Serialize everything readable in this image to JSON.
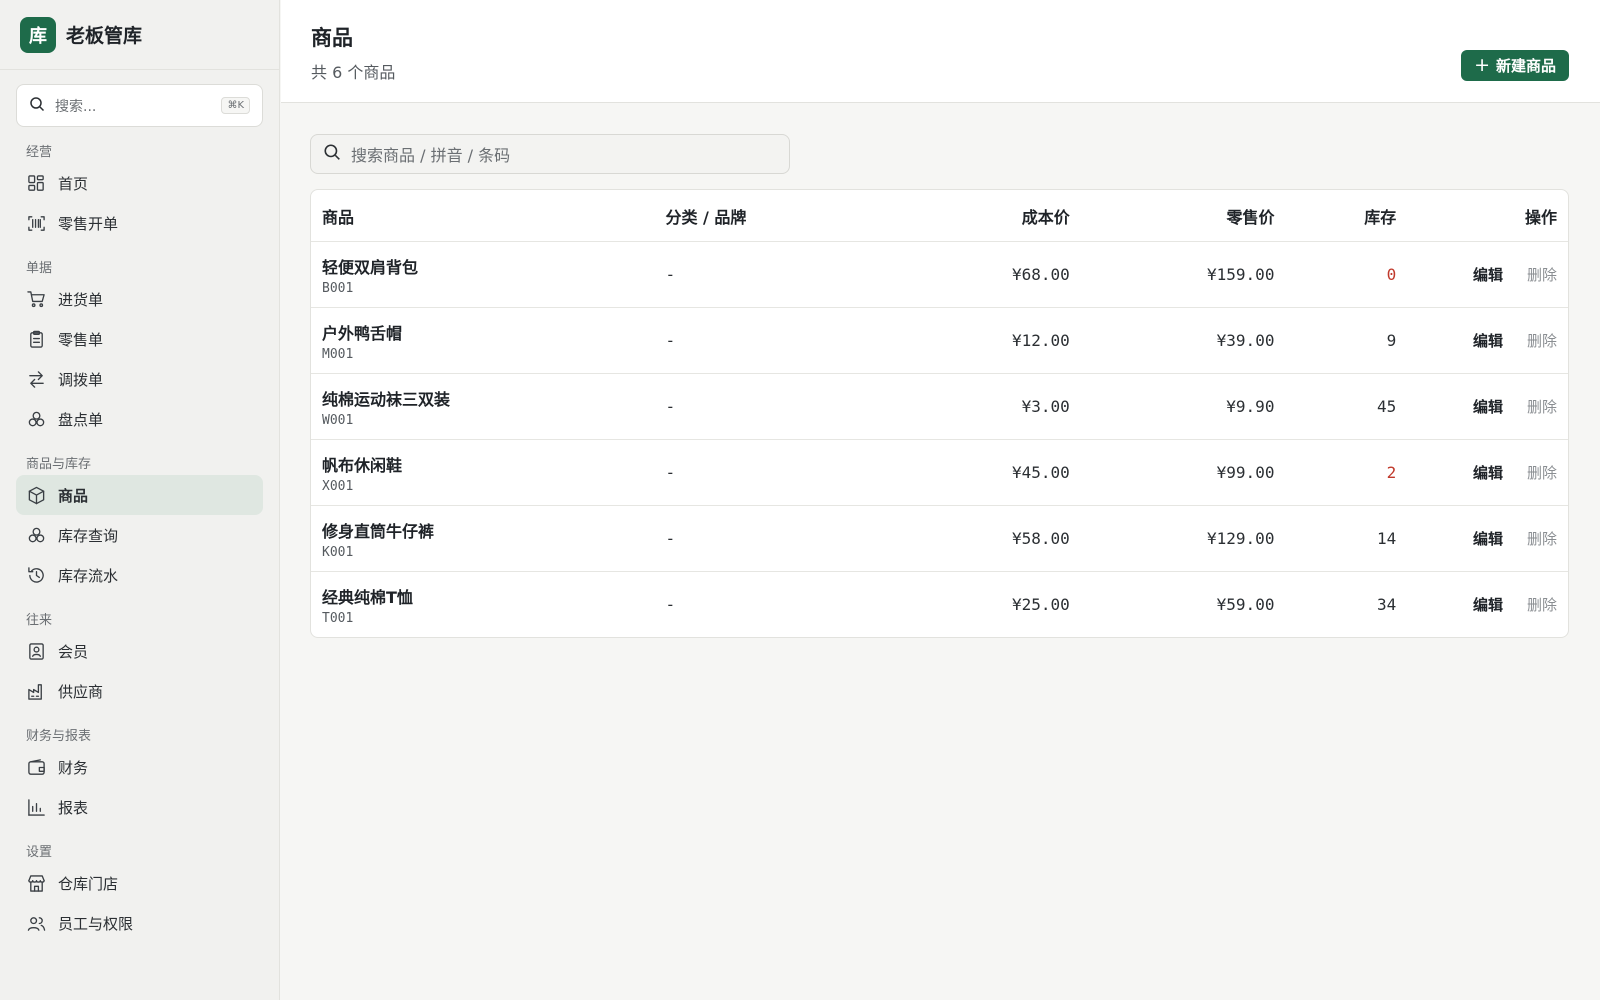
{
  "brand": {
    "logo": "库",
    "name": "老板管库"
  },
  "sidebar_search": {
    "placeholder": "搜索...",
    "shortcut": "⌘K"
  },
  "nav": [
    {
      "title": "经营",
      "items": [
        {
          "label": "首页",
          "icon": "dashboard-icon"
        },
        {
          "label": "零售开单",
          "icon": "scan-icon"
        }
      ]
    },
    {
      "title": "单据",
      "items": [
        {
          "label": "进货单",
          "icon": "cart-icon"
        },
        {
          "label": "零售单",
          "icon": "clipboard-icon"
        },
        {
          "label": "调拨单",
          "icon": "transfer-icon"
        },
        {
          "label": "盘点单",
          "icon": "boxes-icon"
        }
      ]
    },
    {
      "title": "商品与库存",
      "items": [
        {
          "label": "商品",
          "icon": "package-icon",
          "active": true
        },
        {
          "label": "库存查询",
          "icon": "boxes-icon"
        },
        {
          "label": "库存流水",
          "icon": "history-icon"
        }
      ]
    },
    {
      "title": "往来",
      "items": [
        {
          "label": "会员",
          "icon": "contact-icon"
        },
        {
          "label": "供应商",
          "icon": "factory-icon"
        }
      ]
    },
    {
      "title": "财务与报表",
      "items": [
        {
          "label": "财务",
          "icon": "wallet-icon"
        },
        {
          "label": "报表",
          "icon": "bar-chart-icon"
        }
      ]
    },
    {
      "title": "设置",
      "items": [
        {
          "label": "仓库门店",
          "icon": "store-icon"
        },
        {
          "label": "员工与权限",
          "icon": "users-icon"
        }
      ]
    }
  ],
  "header": {
    "title": "商品",
    "subtitle": "共 6 个商品",
    "new_button": "新建商品"
  },
  "search": {
    "placeholder": "搜索商品 / 拼音 / 条码"
  },
  "table": {
    "columns": [
      "商品",
      "分类 / 品牌",
      "成本价",
      "零售价",
      "库存",
      "操作"
    ],
    "rows": [
      {
        "name": "轻便双肩背包",
        "code": "B001",
        "category": "-",
        "cost": "¥68.00",
        "price": "¥159.00",
        "stock": "0",
        "low": true
      },
      {
        "name": "户外鸭舌帽",
        "code": "M001",
        "category": "-",
        "cost": "¥12.00",
        "price": "¥39.00",
        "stock": "9",
        "low": false
      },
      {
        "name": "纯棉运动袜三双装",
        "code": "W001",
        "category": "-",
        "cost": "¥3.00",
        "price": "¥9.90",
        "stock": "45",
        "low": false
      },
      {
        "name": "帆布休闲鞋",
        "code": "X001",
        "category": "-",
        "cost": "¥45.00",
        "price": "¥99.00",
        "stock": "2",
        "low": true
      },
      {
        "name": "修身直筒牛仔裤",
        "code": "K001",
        "category": "-",
        "cost": "¥58.00",
        "price": "¥129.00",
        "stock": "14",
        "low": false
      },
      {
        "name": "经典纯棉T恤",
        "code": "T001",
        "category": "-",
        "cost": "¥25.00",
        "price": "¥59.00",
        "stock": "34",
        "low": false
      }
    ],
    "edit_label": "编辑",
    "delete_label": "删除"
  },
  "colors": {
    "accent": "#1e6b4a",
    "low_stock": "#c0392b"
  }
}
